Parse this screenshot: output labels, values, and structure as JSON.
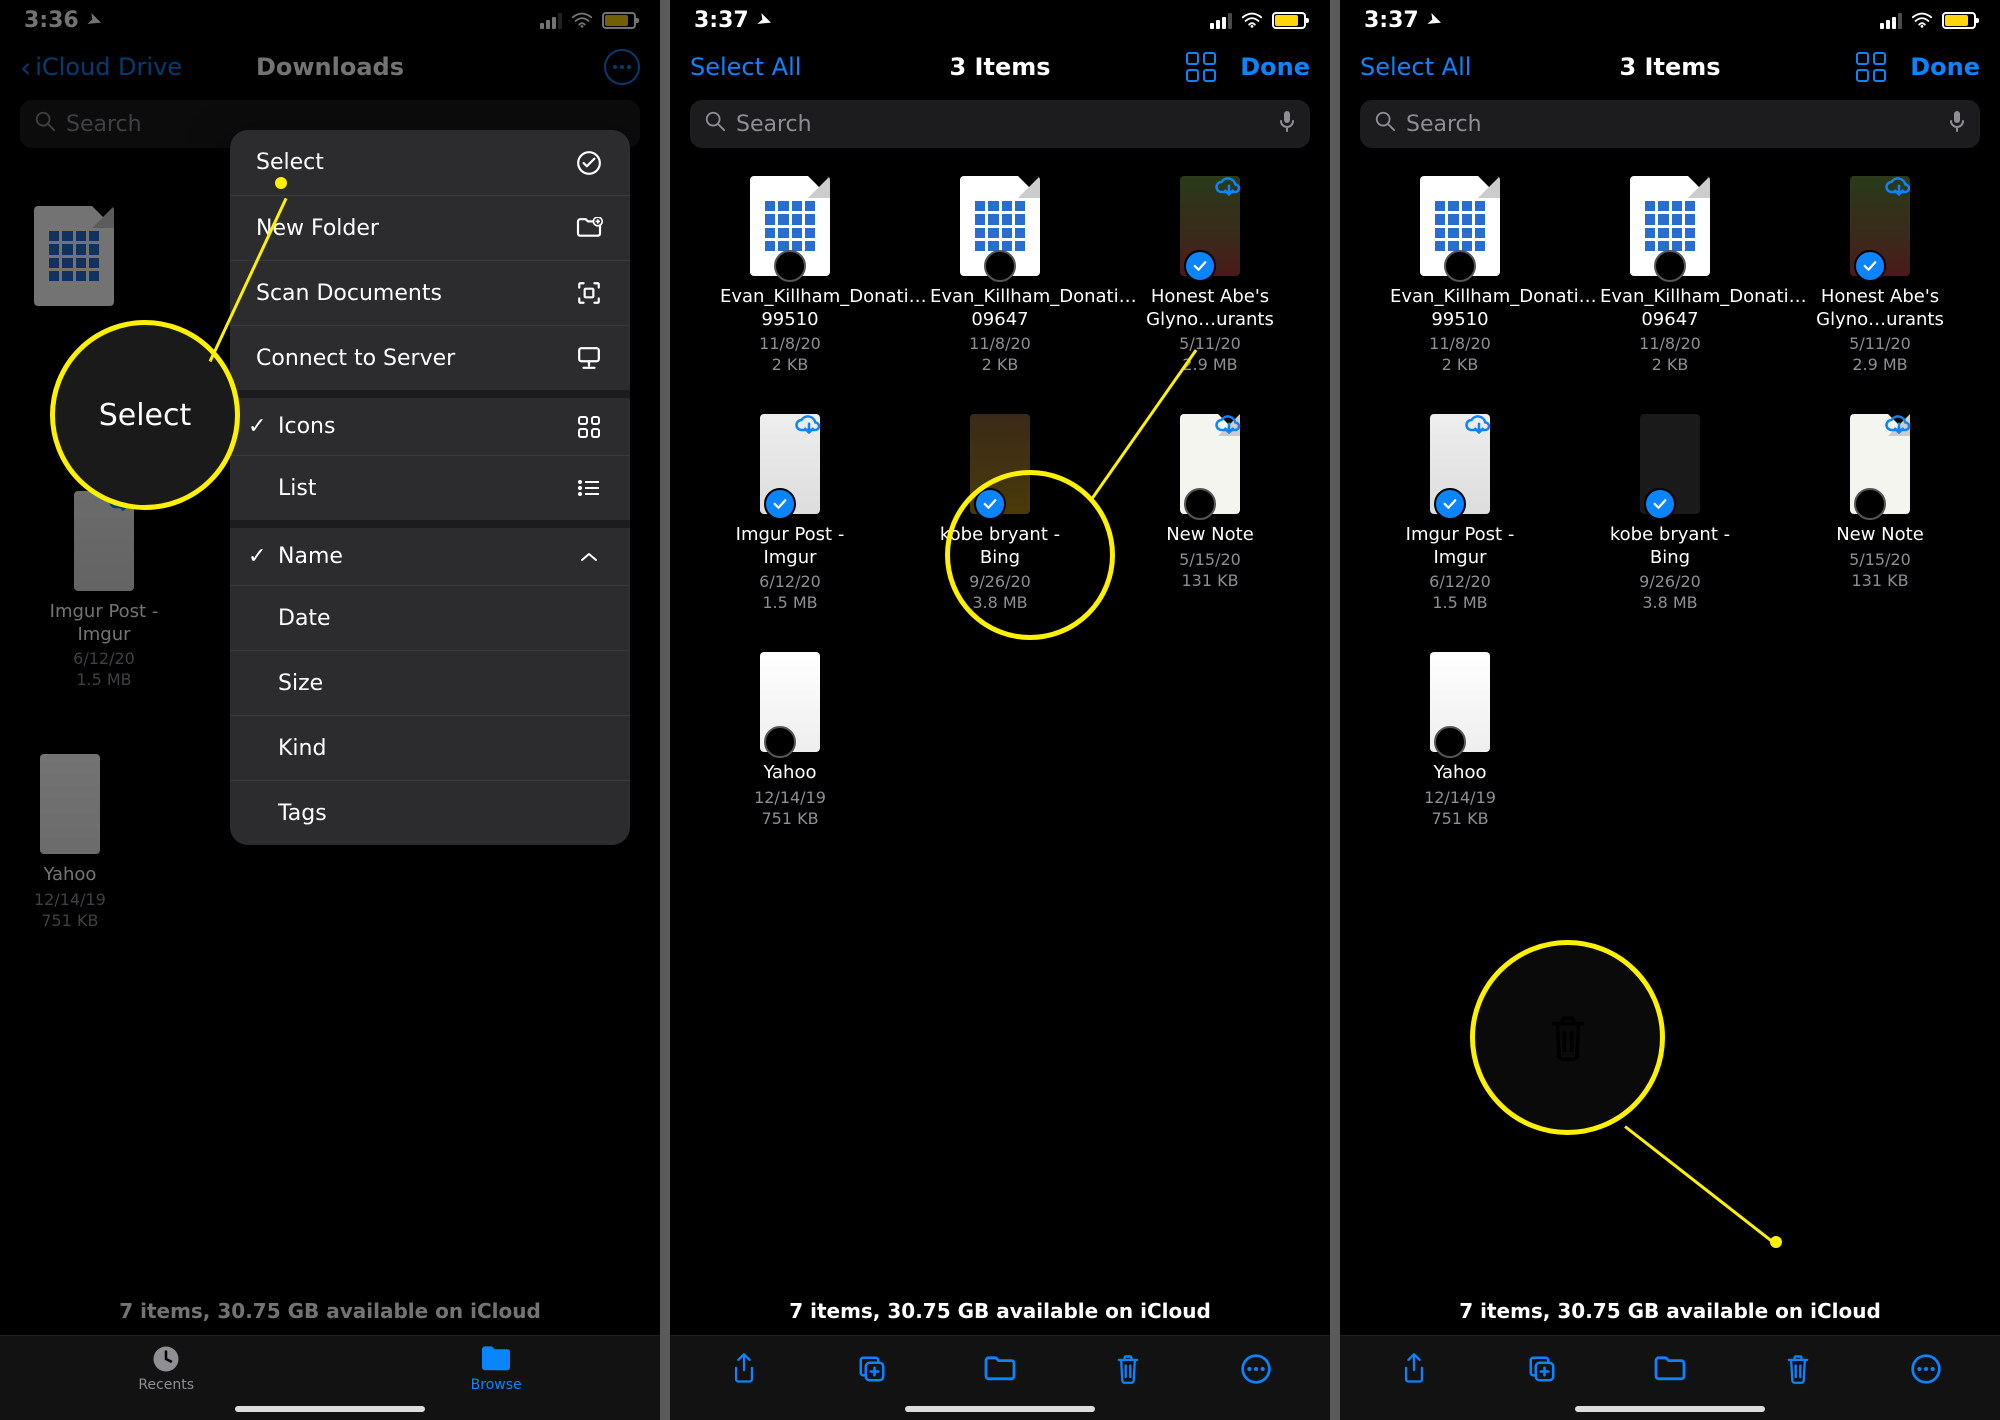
{
  "status": {
    "time1": "3:36",
    "time2": "3:37",
    "time3": "3:37"
  },
  "panel1": {
    "back_label": "iCloud Drive",
    "title": "Downloads",
    "search_placeholder": "Search",
    "menu": {
      "select": "Select",
      "new_folder": "New Folder",
      "scan": "Scan Documents",
      "connect": "Connect to Server",
      "icons": "Icons",
      "list": "List",
      "name": "Name",
      "date": "Date",
      "size": "Size",
      "kind": "Kind",
      "tags": "Tags"
    },
    "big_select": "Select",
    "files": {
      "imgur": {
        "name": "Imgur Post - Imgur",
        "date": "6/12/20",
        "size": "1.5 MB"
      },
      "yahoo": {
        "name": "Yahoo",
        "date": "12/14/19",
        "size": "751 KB"
      }
    },
    "summary": "7 items, 30.75 GB available on iCloud",
    "tab_recents": "Recents",
    "tab_browse": "Browse"
  },
  "panel2": {
    "select_all": "Select All",
    "title": "3 Items",
    "done": "Done",
    "search_placeholder": "Search",
    "files": [
      {
        "name": "Evan_Killham_Donati…99510",
        "date": "11/8/20",
        "size": "2 KB",
        "thumb": "doc",
        "selected": false
      },
      {
        "name": "Evan_Killham_Donati…09647",
        "date": "11/8/20",
        "size": "2 KB",
        "thumb": "doc",
        "selected": false
      },
      {
        "name": "Honest Abe's Glyno…urants",
        "date": "5/11/20",
        "size": "2.9 MB",
        "thumb": "abe",
        "selected": true
      },
      {
        "name": "Imgur Post - Imgur",
        "date": "6/12/20",
        "size": "1.5 MB",
        "thumb": "imgur",
        "selected": true
      },
      {
        "name": "kobe bryant - Bing",
        "date": "9/26/20",
        "size": "3.8 MB",
        "thumb": "kobe",
        "selected": true
      },
      {
        "name": "New Note",
        "date": "5/15/20",
        "size": "131 KB",
        "thumb": "note",
        "selected": false
      },
      {
        "name": "Yahoo",
        "date": "12/14/19",
        "size": "751 KB",
        "thumb": "yahoo",
        "selected": false
      }
    ],
    "summary": "7 items, 30.75 GB available on iCloud"
  },
  "panel3": {
    "select_all": "Select All",
    "title": "3 Items",
    "done": "Done",
    "search_placeholder": "Search",
    "files": [
      {
        "name": "Evan_Killham_Donati…99510",
        "date": "11/8/20",
        "size": "2 KB",
        "thumb": "doc",
        "selected": false
      },
      {
        "name": "Evan_Killham_Donati…09647",
        "date": "11/8/20",
        "size": "2 KB",
        "thumb": "doc",
        "selected": false
      },
      {
        "name": "Honest Abe's Glyno…urants",
        "date": "5/11/20",
        "size": "2.9 MB",
        "thumb": "abe",
        "selected": true
      },
      {
        "name": "Imgur Post - Imgur",
        "date": "6/12/20",
        "size": "1.5 MB",
        "thumb": "imgur",
        "selected": true
      },
      {
        "name": "kobe bryant - Bing",
        "date": "9/26/20",
        "size": "3.8 MB",
        "thumb": "kobedark",
        "selected": true
      },
      {
        "name": "New Note",
        "date": "5/15/20",
        "size": "131 KB",
        "thumb": "note",
        "selected": false
      },
      {
        "name": "Yahoo",
        "date": "12/14/19",
        "size": "751 KB",
        "thumb": "yahoo",
        "selected": false
      }
    ],
    "summary": "7 items, 30.75 GB available on iCloud"
  }
}
